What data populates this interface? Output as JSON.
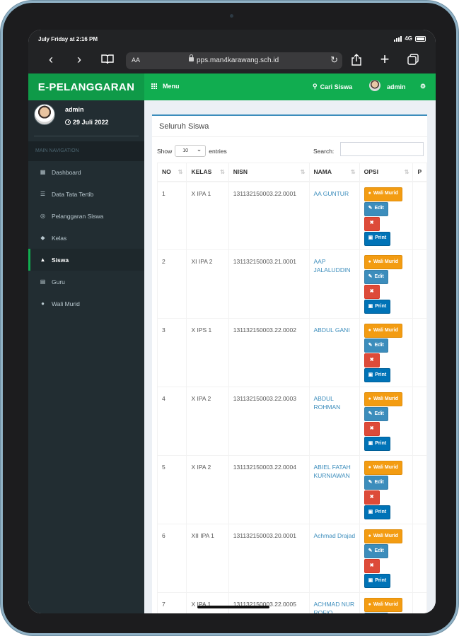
{
  "status_bar": {
    "time": "July Friday at 2:16 PM",
    "network": "4G"
  },
  "browser": {
    "text_size": "AA",
    "url": "pps.man4karawang.sch.id"
  },
  "app": {
    "name": "E-PELANGGARAN",
    "menu_label": "Menu",
    "search_label": "Cari Siswa",
    "user_label": "admin"
  },
  "sidebar": {
    "user_name": "admin",
    "date": "29 Juli 2022",
    "nav_header": "MAIN NAVIGATION",
    "items": [
      {
        "label": "Dashboard",
        "icon": "dashboard-icon"
      },
      {
        "label": "Data Tata Tertib",
        "icon": "list-icon"
      },
      {
        "label": "Pelanggaran Siswa",
        "icon": "circle-icon"
      },
      {
        "label": "Kelas",
        "icon": "tag-icon"
      },
      {
        "label": "Siswa",
        "icon": "graduation-cap-icon",
        "active": true
      },
      {
        "label": "Guru",
        "icon": "table-icon"
      },
      {
        "label": "Wali Murid",
        "icon": "user-icon"
      }
    ]
  },
  "main": {
    "box_title": "Seluruh Siswa",
    "show_label": "Show",
    "entries_value": "10",
    "entries_label": "entries",
    "search_label": "Search:",
    "columns": [
      "NO",
      "KELAS",
      "NISN",
      "NAMA",
      "OPSI",
      "P"
    ],
    "action_labels": {
      "wali": "Wali Murid",
      "edit": "Edit",
      "delete": "✖",
      "print": "Print"
    },
    "rows": [
      {
        "no": "1",
        "kelas": "X IPA 1",
        "nisn": "131132150003.22.0001",
        "nama": "AA GUNTUR"
      },
      {
        "no": "2",
        "kelas": "XI IPA 2",
        "nisn": "131132150003.21.0001",
        "nama": "AAP JALALUDDIN"
      },
      {
        "no": "3",
        "kelas": "X IPS 1",
        "nisn": "131132150003.22.0002",
        "nama": "ABDUL GANI"
      },
      {
        "no": "4",
        "kelas": "X IPA 2",
        "nisn": "131132150003.22.0003",
        "nama": "ABDUL ROHMAN"
      },
      {
        "no": "5",
        "kelas": "X IPA 2",
        "nisn": "131132150003.22.0004",
        "nama": "ABIEL FATAH KURNIAWAN"
      },
      {
        "no": "6",
        "kelas": "XII IPA 1",
        "nisn": "131132150003.20.0001",
        "nama": "Achmad Drajad"
      },
      {
        "no": "7",
        "kelas": "X IPA 1",
        "nisn": "131132150003.22.0005",
        "nama": "ACHMAD NUR ROFIQ"
      }
    ]
  },
  "colors": {
    "brand_green": "#11ad50",
    "logo_green": "#0f9a48",
    "sidebar": "#222d32",
    "link": "#3c8dbc",
    "warning": "#f39c12",
    "danger": "#dd4b39",
    "primary": "#0073b7"
  }
}
